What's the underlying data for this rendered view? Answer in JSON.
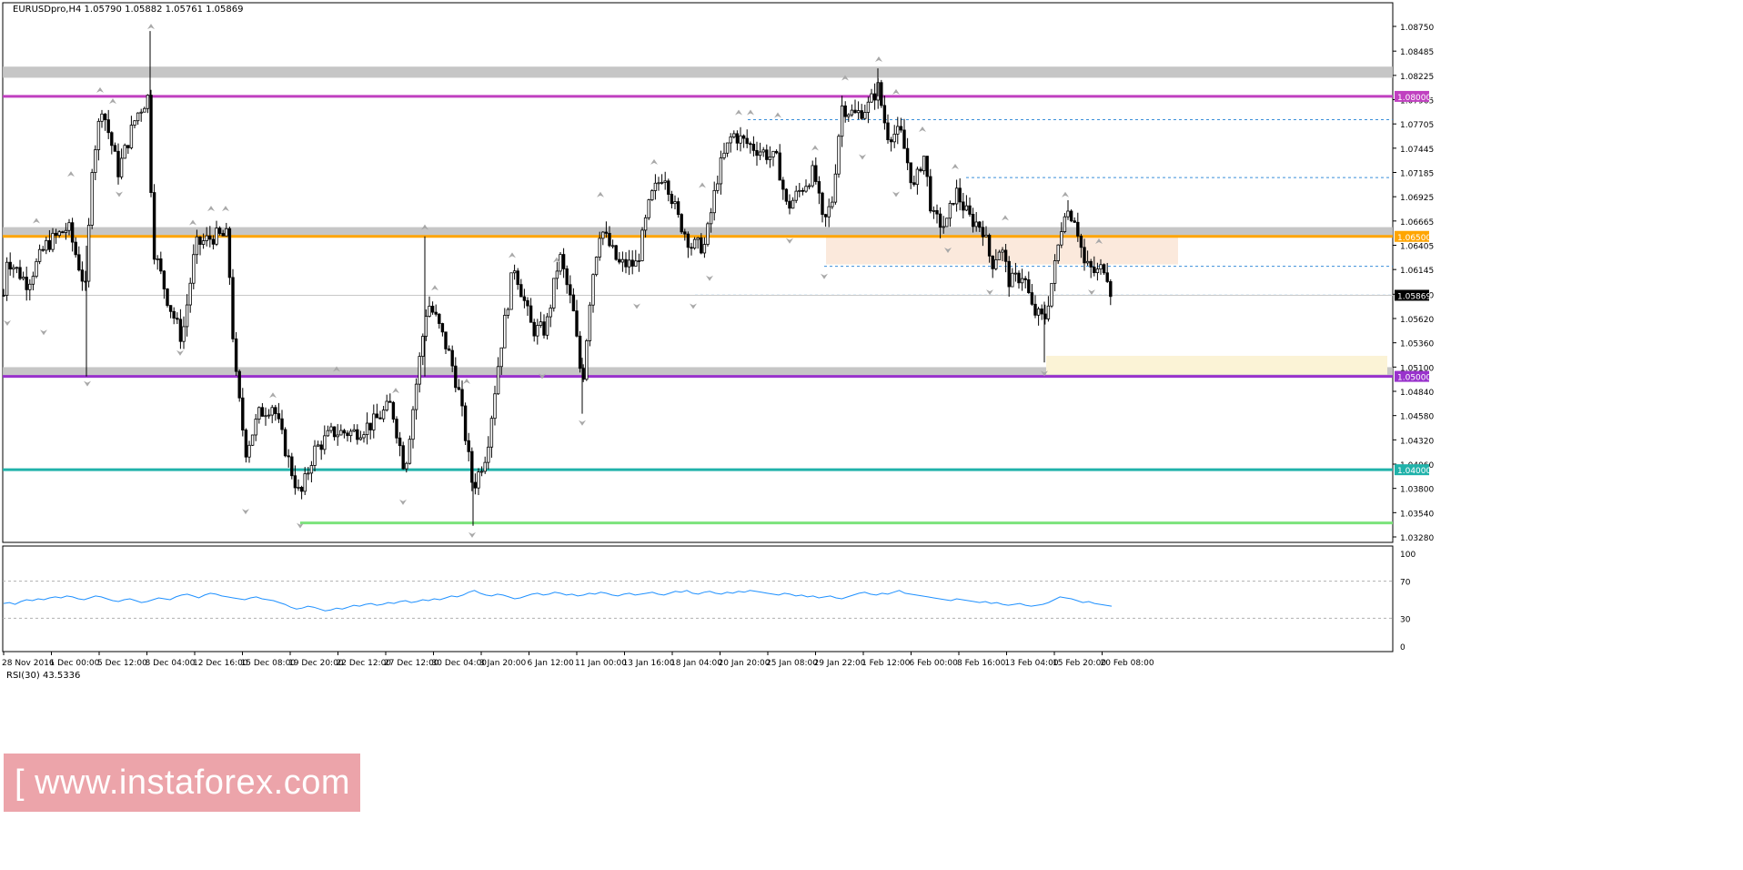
{
  "chart_data": {
    "type": "candlestick",
    "symbol_header": "EURUSDpro,H4  1.05790 1.05882 1.05761 1.05869",
    "price_axis_ticks": [
      "1.08750",
      "1.08485",
      "1.08225",
      "1.07965",
      "1.07705",
      "1.07445",
      "1.07185",
      "1.06925",
      "1.06665",
      "1.06405",
      "1.06145",
      "1.05880",
      "1.05620",
      "1.05360",
      "1.05100",
      "1.04840",
      "1.04580",
      "1.04320",
      "1.04060",
      "1.03800",
      "1.03540",
      "1.03280"
    ],
    "ylim": [
      1.0328,
      1.0875
    ],
    "time_axis_labels": [
      "28 Nov 2016",
      "1 Dec 00:00",
      "5 Dec 12:00",
      "8 Dec 04:00",
      "12 Dec 16:00",
      "15 Dec 08:00",
      "19 Dec 20:00",
      "22 Dec 12:00",
      "27 Dec 12:00",
      "30 Dec 04:00",
      "3 Jan 20:00",
      "6 Jan 12:00",
      "11 Jan 00:00",
      "13 Jan 16:00",
      "18 Jan 04:00",
      "20 Jan 20:00",
      "25 Jan 08:00",
      "29 Jan 22:00",
      "1 Feb 12:00",
      "6 Feb 00:00",
      "8 Feb 16:00",
      "13 Feb 04:00",
      "15 Feb 20:00",
      "20 Feb 08:00"
    ],
    "current_price": "1.05869",
    "current_value": 1.05869,
    "levels": [
      {
        "label": "1.08000",
        "value": 1.08,
        "color": "#c040c0"
      },
      {
        "label": "1.06500",
        "value": 1.065,
        "color": "#ffa500"
      },
      {
        "label": "1.05000",
        "value": 1.05,
        "color": "#9932cc"
      },
      {
        "label": "1.04000",
        "value": 1.04,
        "color": "#20b2aa"
      }
    ],
    "zones": [
      {
        "from": 1.082,
        "to": 1.0828,
        "color": "#c0c0c0"
      },
      {
        "from": 1.065,
        "to": 1.0656,
        "color": "#c0c0c0"
      },
      {
        "from": 1.05,
        "to": 1.0506,
        "color": "#c0c0c0"
      }
    ],
    "dashed_levels": [
      1.0775,
      1.0713,
      1.0618,
      1.0587
    ],
    "green_support": 1.0343,
    "rsi": {
      "label": "RSI(30) 43.5336",
      "value": 43.5336,
      "ticks": [
        "100",
        "70",
        "30",
        "0"
      ],
      "levels": [
        70,
        30
      ],
      "series": [
        46,
        47,
        45,
        48,
        50,
        49,
        51,
        50,
        52,
        53,
        52,
        54,
        53,
        51,
        50,
        52,
        54,
        53,
        51,
        49,
        48,
        50,
        51,
        49,
        47,
        48,
        50,
        52,
        51,
        50,
        53,
        55,
        56,
        54,
        52,
        55,
        57,
        56,
        54,
        53,
        52,
        51,
        50,
        52,
        53,
        51,
        50,
        49,
        47,
        45,
        42,
        40,
        41,
        43,
        42,
        40,
        38,
        39,
        41,
        40,
        42,
        44,
        43,
        45,
        46,
        44,
        45,
        47,
        46,
        48,
        49,
        47,
        48,
        50,
        49,
        51,
        50,
        52,
        54,
        53,
        55,
        58,
        60,
        57,
        55,
        54,
        56,
        55,
        53,
        51,
        52,
        54,
        56,
        57,
        55,
        56,
        58,
        57,
        55,
        56,
        54,
        55,
        57,
        56,
        58,
        57,
        55,
        54,
        56,
        57,
        55,
        56,
        57,
        58,
        56,
        55,
        57,
        59,
        58,
        60,
        57,
        56,
        58,
        59,
        57,
        56,
        58,
        57,
        59,
        58,
        60,
        59,
        58,
        57,
        56,
        55,
        57,
        56,
        54,
        55,
        53,
        54,
        52,
        53,
        54,
        52,
        51,
        53,
        55,
        57,
        58,
        56,
        55,
        57,
        56,
        58,
        60,
        57,
        56,
        55,
        54,
        53,
        52,
        51,
        50,
        49,
        51,
        50,
        49,
        48,
        47,
        48,
        46,
        47,
        45,
        44,
        45,
        46,
        44,
        43,
        44,
        45,
        47,
        50,
        53,
        52,
        51,
        49,
        47,
        48,
        46,
        45,
        44,
        43
      ]
    }
  },
  "branding": {
    "watermark": "[ www.instaforex.com ]"
  }
}
